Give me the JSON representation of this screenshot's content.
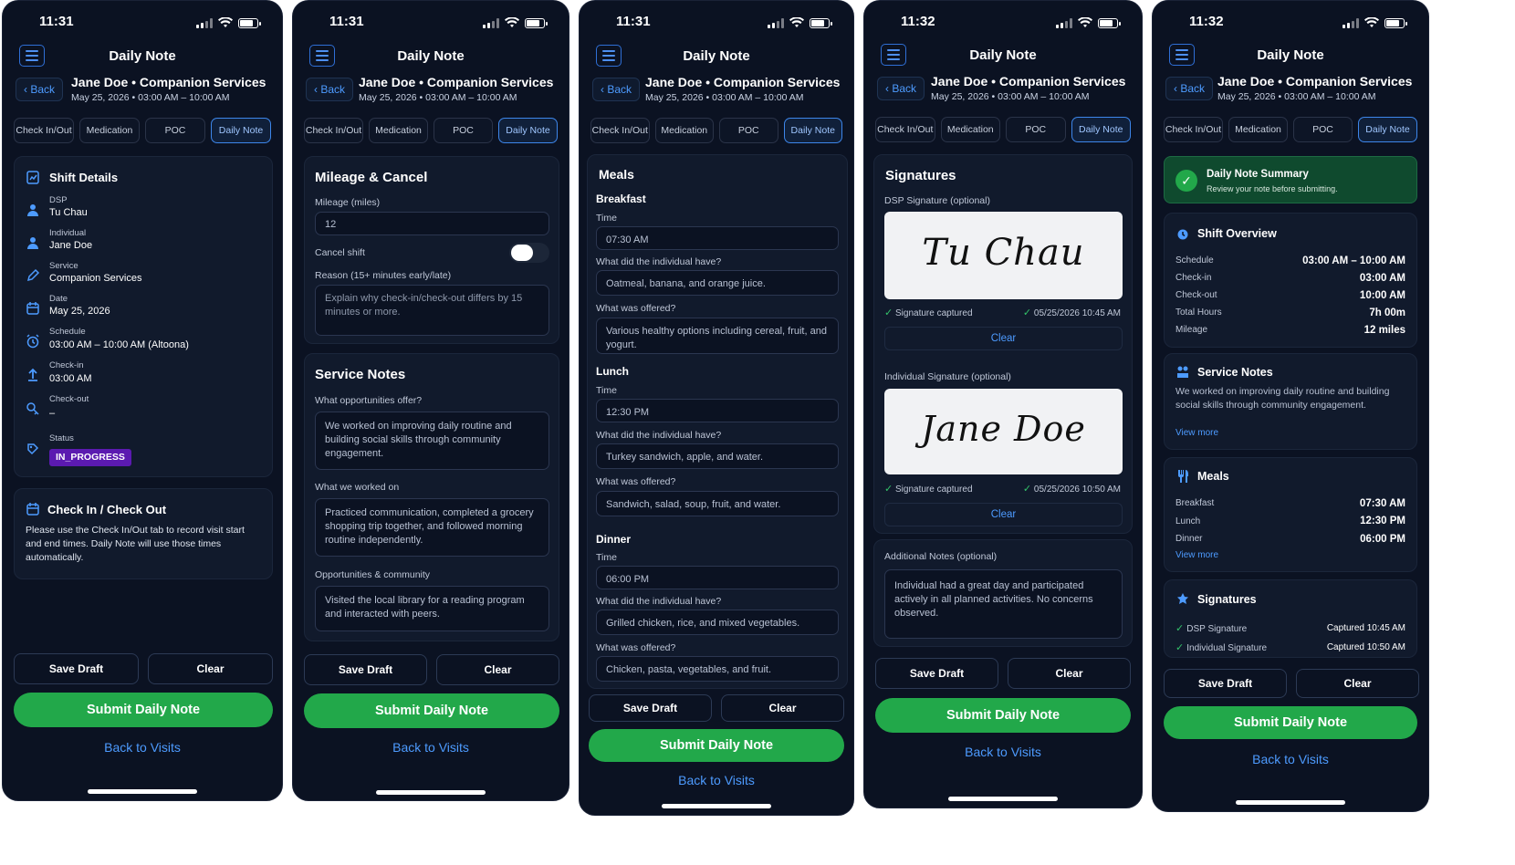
{
  "common": {
    "title": "Daily Note",
    "back": "Back",
    "name_service": "Jane Doe • Companion Services",
    "meta": "May 25, 2026  •  03:00 AM – 10:00 AM",
    "tabs": [
      "Check In/Out",
      "Medication",
      "POC",
      "Daily Note"
    ],
    "save_draft": "Save Draft",
    "clear": "Clear",
    "submit": "Submit Daily Note",
    "back_to_visits": "Back to Visits"
  },
  "screens": [
    {
      "time": "11:31"
    },
    {
      "time": "11:31"
    },
    {
      "time": "11:31"
    },
    {
      "time": "11:32"
    },
    {
      "time": "11:32"
    }
  ],
  "s1": {
    "shift_title": "Shift Details",
    "dsp_label": "DSP",
    "dsp_value": "Tu Chau",
    "individual_label": "Individual",
    "individual_value": "Jane Doe",
    "service_label": "Service",
    "service_value": "Companion Services",
    "date_label": "Date",
    "date_value": "May 25, 2026",
    "schedule_label": "Schedule",
    "schedule_value": "03:00 AM – 10:00 AM (Altoona)",
    "checkin_label": "Check-in",
    "checkin_value": "03:00 AM",
    "checkout_label": "Check-out",
    "checkout_value": "–",
    "status_label": "Status",
    "status_value": "IN_PROGRESS",
    "cio_title": "Check In / Check Out",
    "cio_body": "Please use the Check In/Out tab to record visit start and end times. Daily Note will use those times automatically."
  },
  "s2": {
    "mileage_title": "Mileage & Cancel",
    "mileage_label": "Mileage (miles)",
    "mileage_value": "12",
    "cancel_label": "Cancel shift",
    "reason_label": "Reason (15+ minutes early/late)",
    "reason_placeholder": "Explain why check-in/check-out differs by 15 minutes or more.",
    "service_title": "Service Notes",
    "opp_label": "What opportunities offer?",
    "opp_value": "We worked on improving daily routine and building social skills through community engagement.",
    "worked_label": "What we worked on",
    "worked_value": "Practiced communication, completed a grocery shopping trip together, and followed morning routine independently.",
    "community_label": "Opportunities & community",
    "community_value": "Visited the local library for a reading program and interacted with peers."
  },
  "s3": {
    "meals_title": "Meals",
    "time_label": "Time",
    "have_label": "What did the individual have?",
    "offered_label": "What was offered?",
    "breakfast": {
      "name": "Breakfast",
      "time": "07:30 AM",
      "had": "Oatmeal, banana, and orange juice.",
      "offered": "Various healthy options including cereal, fruit, and yogurt."
    },
    "lunch": {
      "name": "Lunch",
      "time": "12:30 PM",
      "had": "Turkey sandwich, apple, and water.",
      "offered": "Sandwich, salad, soup, fruit, and water."
    },
    "dinner": {
      "name": "Dinner",
      "time": "06:00 PM",
      "had": "Grilled chicken, rice, and mixed vegetables.",
      "offered": "Chicken, pasta, vegetables, and fruit."
    }
  },
  "s4": {
    "sig_title": "Signatures",
    "dsp_sig_label": "DSP Signature (optional)",
    "dsp_sig_text": "Tu Chau",
    "captured": "Signature captured",
    "dsp_sig_time": "05/25/2026 10:45 AM",
    "ind_sig_label": "Individual Signature (optional)",
    "ind_sig_text": "Jane Doe",
    "ind_sig_time": "05/25/2026 10:50 AM",
    "addl_label": "Additional Notes (optional)",
    "addl_value": "Individual had a great day and participated actively in all planned activities. No concerns observed."
  },
  "s5": {
    "summary_title": "Daily Note Summary",
    "summary_sub": "Review your note before submitting.",
    "overview_title": "Shift Overview",
    "overview": [
      {
        "k": "Schedule",
        "v": "03:00 AM – 10:00 AM"
      },
      {
        "k": "Check-in",
        "v": "03:00 AM"
      },
      {
        "k": "Check-out",
        "v": "10:00 AM"
      },
      {
        "k": "Total Hours",
        "v": "7h 00m"
      },
      {
        "k": "Mileage",
        "v": "12 miles"
      }
    ],
    "service_title": "Service Notes",
    "service_body": "We worked on improving daily routine and building social skills through community engagement.",
    "view_more": "View more",
    "meals_title": "Meals",
    "meals": [
      {
        "k": "Breakfast",
        "v": "07:30 AM"
      },
      {
        "k": "Lunch",
        "v": "12:30 PM"
      },
      {
        "k": "Dinner",
        "v": "06:00 PM"
      }
    ],
    "sig_title": "Signatures",
    "sigs": [
      {
        "k": "DSP Signature",
        "v": "Captured 10:45 AM"
      },
      {
        "k": "Individual Signature",
        "v": "Captured 10:50 AM"
      }
    ]
  }
}
